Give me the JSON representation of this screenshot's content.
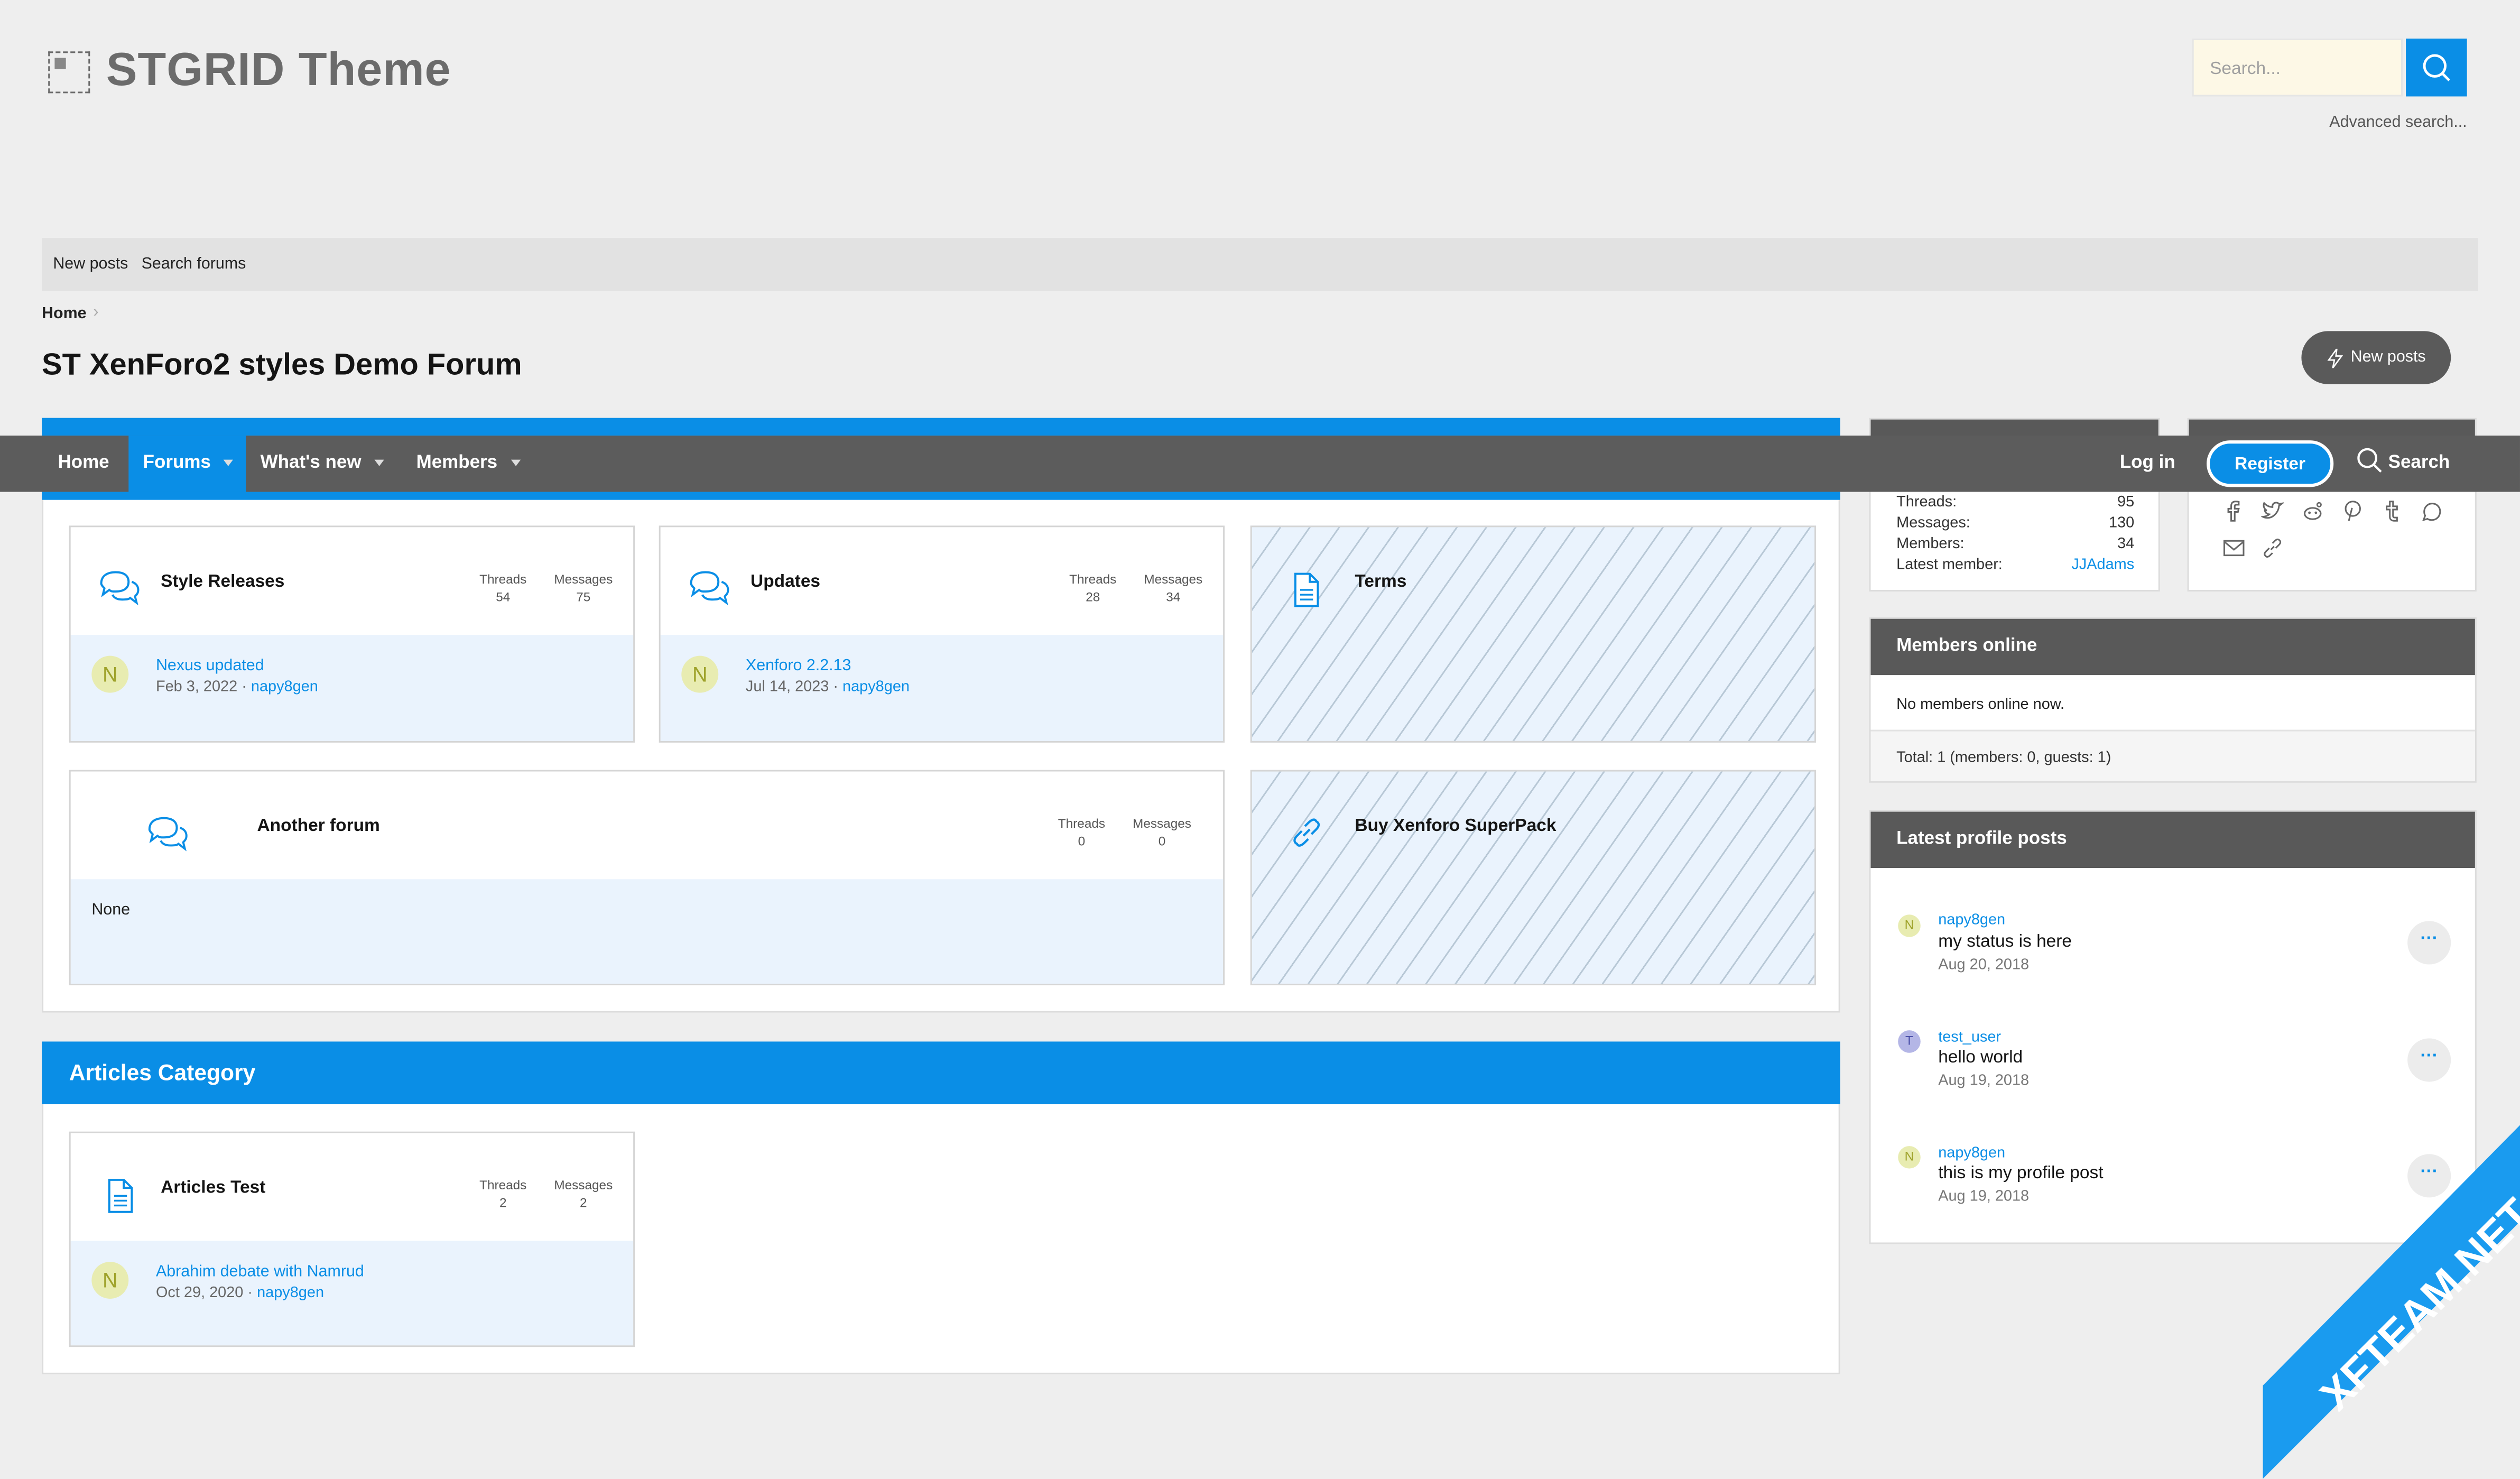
{
  "header": {
    "logo_text": "STGRID Theme",
    "search_placeholder": "Search...",
    "advanced_search": "Advanced search..."
  },
  "subnav": {
    "new_posts": "New posts",
    "search_forums": "Search forums"
  },
  "breadcrumb": {
    "home": "Home",
    "separator": "›"
  },
  "page_title": "ST XenForo2 styles Demo Forum",
  "new_posts_button": "New posts",
  "navbar": {
    "home": "Home",
    "forums": "Forums",
    "whats_new": "What's new",
    "members": "Members",
    "login": "Log in",
    "register": "Register",
    "search": "Search"
  },
  "forums": [
    {
      "title": "Style Releases",
      "threads_label": "Threads",
      "threads": "54",
      "messages_label": "Messages",
      "messages": "75",
      "avatar": "N",
      "last_title": "Nexus updated",
      "last_date": "Feb 3, 2022",
      "last_user": "napy8gen",
      "dot": "·"
    },
    {
      "title": "Updates",
      "threads_label": "Threads",
      "threads": "28",
      "messages_label": "Messages",
      "messages": "34",
      "avatar": "N",
      "last_title": "Xenforo 2.2.13",
      "last_date": "Jul 14, 2023",
      "last_user": "napy8gen",
      "dot": "·"
    },
    {
      "title": "Terms"
    },
    {
      "title": "Another forum",
      "threads_label": "Threads",
      "threads": "0",
      "messages_label": "Messages",
      "messages": "0",
      "none": "None"
    },
    {
      "title": "Buy Xenforo SuperPack"
    }
  ],
  "articles": {
    "category": "Articles Category",
    "title": "Articles Test",
    "threads_label": "Threads",
    "threads": "2",
    "messages_label": "Messages",
    "messages": "2",
    "avatar": "N",
    "last_title": "Abrahim debate with Namrud",
    "last_date": "Oct 29, 2020",
    "last_user": "napy8gen",
    "dot": "·"
  },
  "stats": {
    "threads_label": "Threads:",
    "threads": "95",
    "messages_label": "Messages:",
    "messages": "130",
    "members_label": "Members:",
    "members": "34",
    "latest_label": "Latest member:",
    "latest": "JJAdams"
  },
  "members_online": {
    "title": "Members online",
    "none": "No members online now.",
    "total": "Total: 1 (members: 0, guests: 1)"
  },
  "profile_posts": {
    "title": "Latest profile posts",
    "more": "···",
    "items": [
      {
        "avatar": "N",
        "user": "napy8gen",
        "msg": "my status is here",
        "date": "Aug 20, 2018"
      },
      {
        "avatar": "T",
        "user": "test_user",
        "msg": "hello world",
        "date": "Aug 19, 2018"
      },
      {
        "avatar": "N",
        "user": "napy8gen",
        "msg": "this is my profile post",
        "date": "Aug 19, 2018"
      }
    ]
  },
  "watermark": "XFTEAM.NET",
  "colors": {
    "accent": "#0a8ee6",
    "nav": "#5c5c5c",
    "card_bg": "#eaf3fd"
  }
}
